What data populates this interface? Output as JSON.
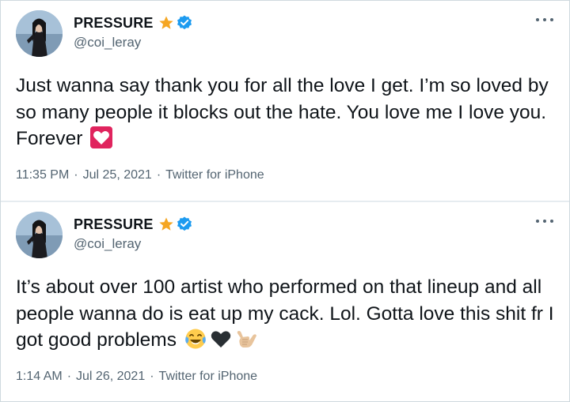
{
  "tweets": [
    {
      "display_name": "PRESSURE",
      "handle": "@coi_leray",
      "text": "Just wanna say thank you for all the love I get. I’m so loved by so many people it blocks out the hate. You love me I love you. Forever",
      "emoji": [
        "heart-box-emoji"
      ],
      "time": "11:35 PM",
      "date": "Jul 25, 2021",
      "source": "Twitter for iPhone",
      "more_icon": "ellipsis-icon",
      "badges": [
        "star-icon",
        "verified-icon"
      ]
    },
    {
      "display_name": "PRESSURE",
      "handle": "@coi_leray",
      "text": "It’s about over 100 artist who performed on that lineup and all people wanna do is eat up my cack. Lol. Gotta love this shit fr I got good problems",
      "emoji": [
        "tears-of-joy-emoji",
        "black-heart-emoji",
        "call-me-hand-emoji"
      ],
      "time": "1:14 AM",
      "date": "Jul 26, 2021",
      "source": "Twitter for iPhone",
      "more_icon": "ellipsis-icon",
      "badges": [
        "star-icon",
        "verified-icon"
      ]
    }
  ],
  "meta_separator": "·",
  "colors": {
    "text": "#0f1419",
    "secondary": "#536471",
    "verified": "#1d9bf0",
    "star": "#f5a623",
    "heart_box": "#e0245e",
    "border": "#cfd9de"
  }
}
